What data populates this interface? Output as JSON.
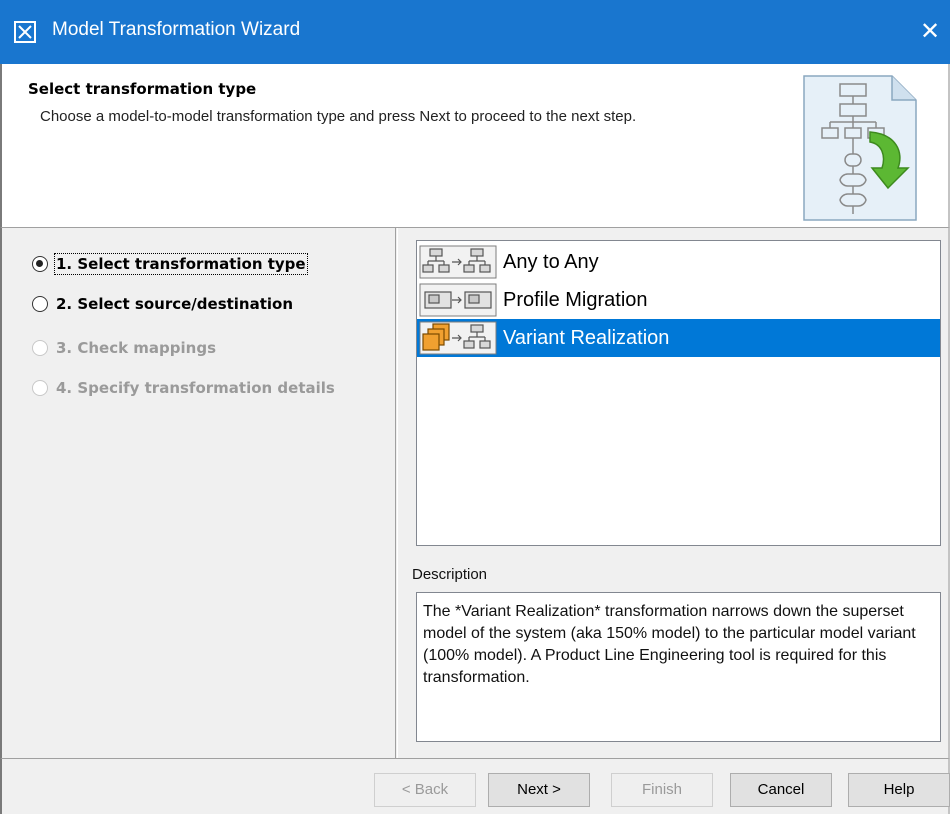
{
  "window": {
    "title": "Model Transformation Wizard",
    "close_glyph": "✕"
  },
  "header": {
    "title": "Select transformation type",
    "description": "Choose a model-to-model transformation type and press Next to proceed to the next step."
  },
  "steps": [
    {
      "label": "1. Select transformation type",
      "checked": true,
      "enabled": true
    },
    {
      "label": "2. Select source/destination",
      "checked": false,
      "enabled": true
    },
    {
      "label": "3. Check mappings",
      "checked": false,
      "enabled": false
    },
    {
      "label": "4. Specify transformation details",
      "checked": false,
      "enabled": false
    }
  ],
  "transformation_types": [
    {
      "label": "Any to Any",
      "icon": "any-to-any-icon",
      "selected": false
    },
    {
      "label": "Profile Migration",
      "icon": "profile-migration-icon",
      "selected": false
    },
    {
      "label": "Variant Realization",
      "icon": "variant-realization-icon",
      "selected": true
    }
  ],
  "description": {
    "label": "Description",
    "text": "The *Variant Realization* transformation narrows down the superset model of the system (aka 150% model) to the particular model variant (100% model). A Product Line Engineering tool is required for this transformation."
  },
  "buttons": {
    "back": "< Back",
    "next": "Next >",
    "finish": "Finish",
    "cancel": "Cancel",
    "help": "Help"
  },
  "colors": {
    "titlebar": "#1976cf",
    "selection": "#0078d7"
  }
}
